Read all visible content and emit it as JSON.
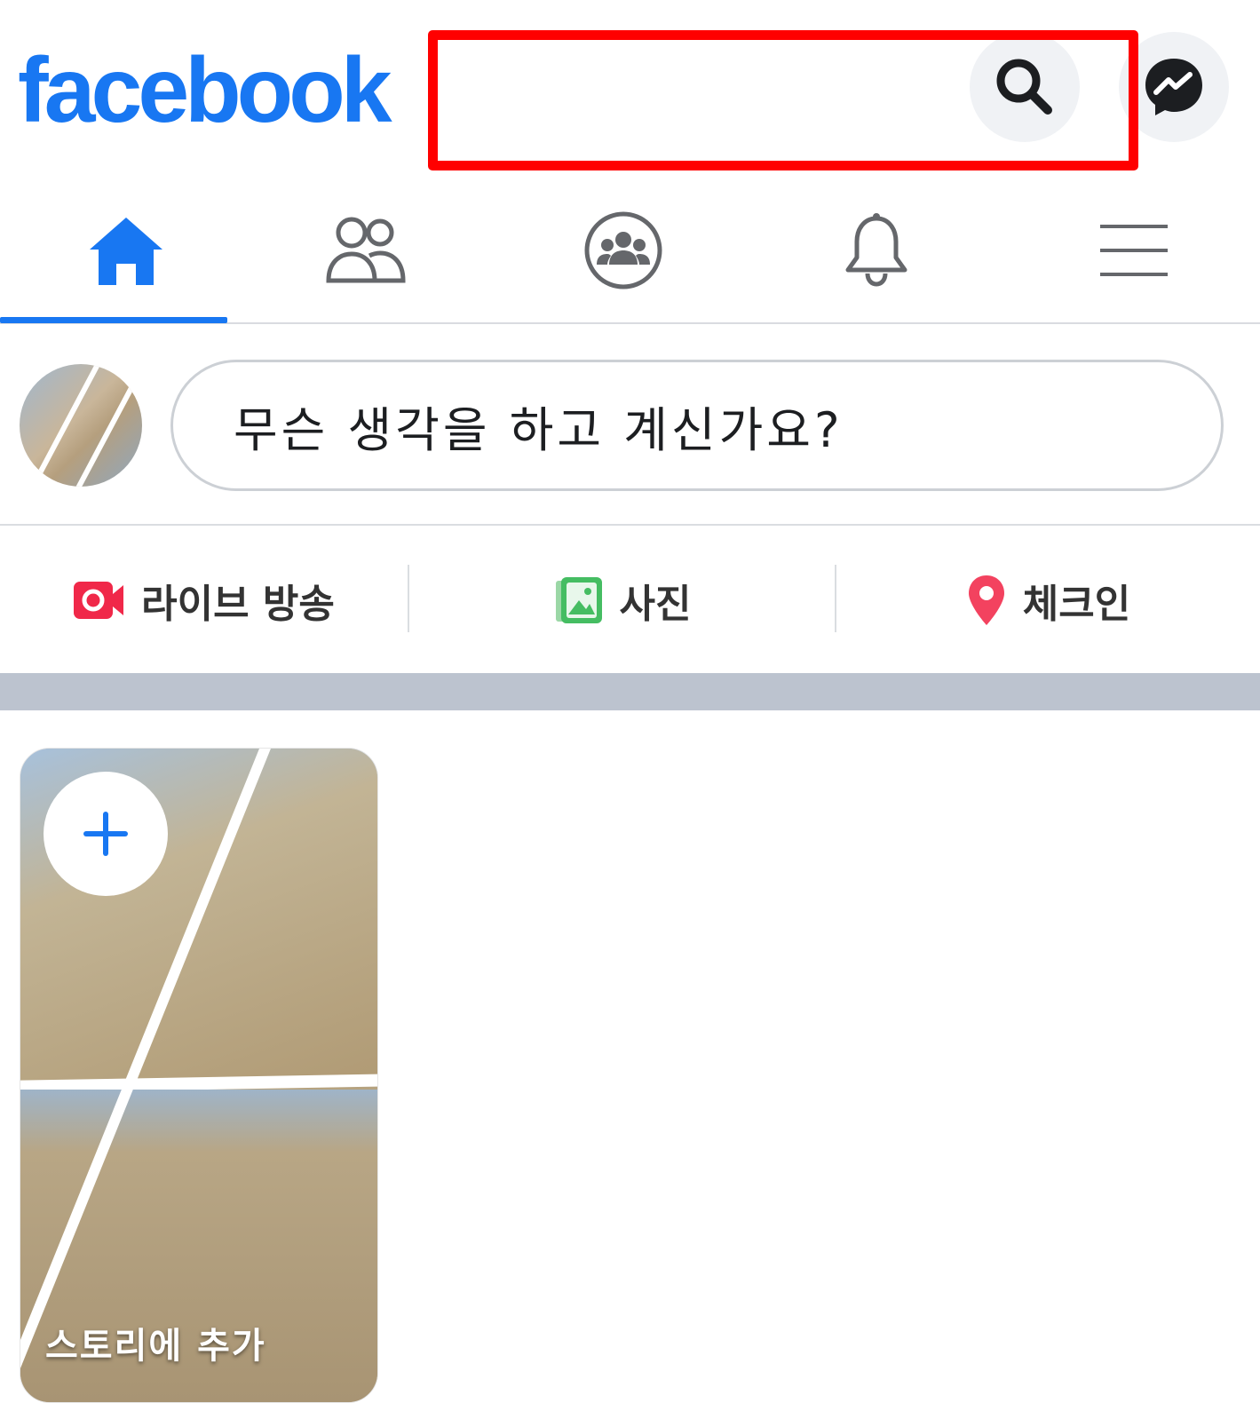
{
  "header": {
    "logo_text": "facebook",
    "brand_color": "#1877f2",
    "search_icon": "search-icon",
    "messenger_icon": "messenger-icon",
    "highlight_color": "#ff0000"
  },
  "nav": {
    "tabs": [
      {
        "icon": "home-icon",
        "active": true
      },
      {
        "icon": "friends-icon",
        "active": false
      },
      {
        "icon": "groups-icon",
        "active": false
      },
      {
        "icon": "notifications-bell-icon",
        "active": false
      },
      {
        "icon": "menu-icon",
        "active": false
      }
    ]
  },
  "composer": {
    "placeholder": "무슨 생각을 하고 계신가요?"
  },
  "actions": {
    "live_label": "라이브 방송",
    "photo_label": "사진",
    "checkin_label": "체크인",
    "live_color": "#f02849",
    "photo_color": "#45bd62",
    "checkin_color": "#f3425f"
  },
  "story": {
    "add_label": "스토리에 추가"
  }
}
